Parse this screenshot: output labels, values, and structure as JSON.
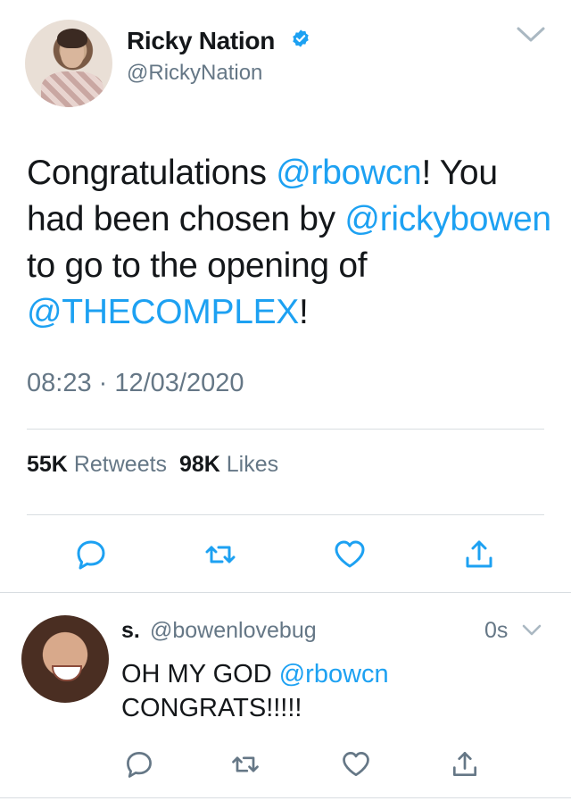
{
  "tweet": {
    "author_name": "Ricky Nation",
    "author_handle": "@RickyNation",
    "verified_icon": "verified-badge-icon",
    "text_parts": [
      {
        "text": "Congratulations ",
        "type": "text"
      },
      {
        "text": "@rbowcn",
        "type": "mention"
      },
      {
        "text": "! You had been chosen by ",
        "type": "text"
      },
      {
        "text": "@rickybowen",
        "type": "mention"
      },
      {
        "text": " to go to the opening of ",
        "type": "text"
      },
      {
        "text": "@THECOMPLEX",
        "type": "mention"
      },
      {
        "text": "!",
        "type": "text"
      }
    ],
    "time": "08:23",
    "date": "12/03/2020",
    "retweets_count": "55K",
    "retweets_label": "Retweets",
    "likes_count": "98K",
    "likes_label": "Likes",
    "actions": [
      "reply-icon",
      "retweet-icon",
      "like-icon",
      "share-icon"
    ]
  },
  "reply": {
    "author_name": "s.",
    "author_handle": "@bowenlovebug",
    "time": "0s",
    "text_parts": [
      {
        "text": "OH MY GOD ",
        "type": "text"
      },
      {
        "text": "@rbowcn",
        "type": "mention"
      },
      {
        "text": " CONGRATS!!!!!",
        "type": "text"
      }
    ]
  },
  "colors": {
    "accent": "#1da1f2",
    "secondary_text": "#657786",
    "primary_text": "#14171a",
    "divider": "#d8dde1"
  }
}
